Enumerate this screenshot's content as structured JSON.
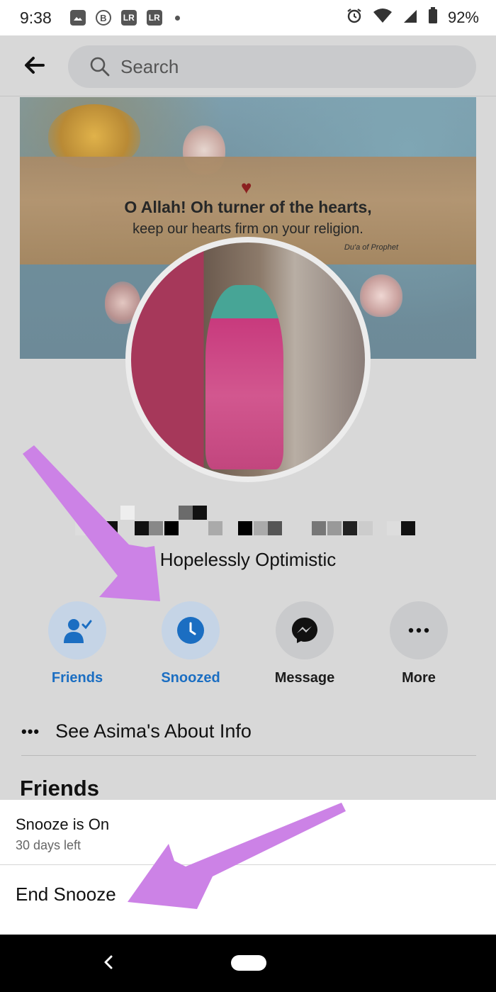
{
  "status_bar": {
    "time": "9:38",
    "notification_icons": [
      "image-icon",
      "b-icon",
      "lr-icon",
      "lr-icon"
    ],
    "lr_label": "LR",
    "b_label": "B",
    "battery": "92%"
  },
  "header": {
    "search_placeholder": "Search"
  },
  "cover": {
    "quote_line1": "O Allah! Oh turner of the hearts,",
    "quote_line2": "keep our hearts firm on your religion.",
    "quote_credit": "Du'a of Prophet"
  },
  "profile": {
    "bio": "Hopelessly Optimistic"
  },
  "actions": [
    {
      "label": "Friends",
      "icon": "friends-check-icon",
      "active": true
    },
    {
      "label": "Snoozed",
      "icon": "clock-icon",
      "active": true
    },
    {
      "label": "Message",
      "icon": "messenger-icon",
      "active": false
    },
    {
      "label": "More",
      "icon": "more-dots-icon",
      "active": false
    }
  ],
  "about_row": {
    "label": "See Asima's About Info"
  },
  "sections": {
    "friends_heading": "Friends"
  },
  "snooze_sheet": {
    "title": "Snooze is On",
    "subtitle": "30 days left",
    "end_label": "End Snooze"
  },
  "colors": {
    "accent_blue": "#1b6ec2",
    "annotation_arrow": "#cc82e6"
  }
}
